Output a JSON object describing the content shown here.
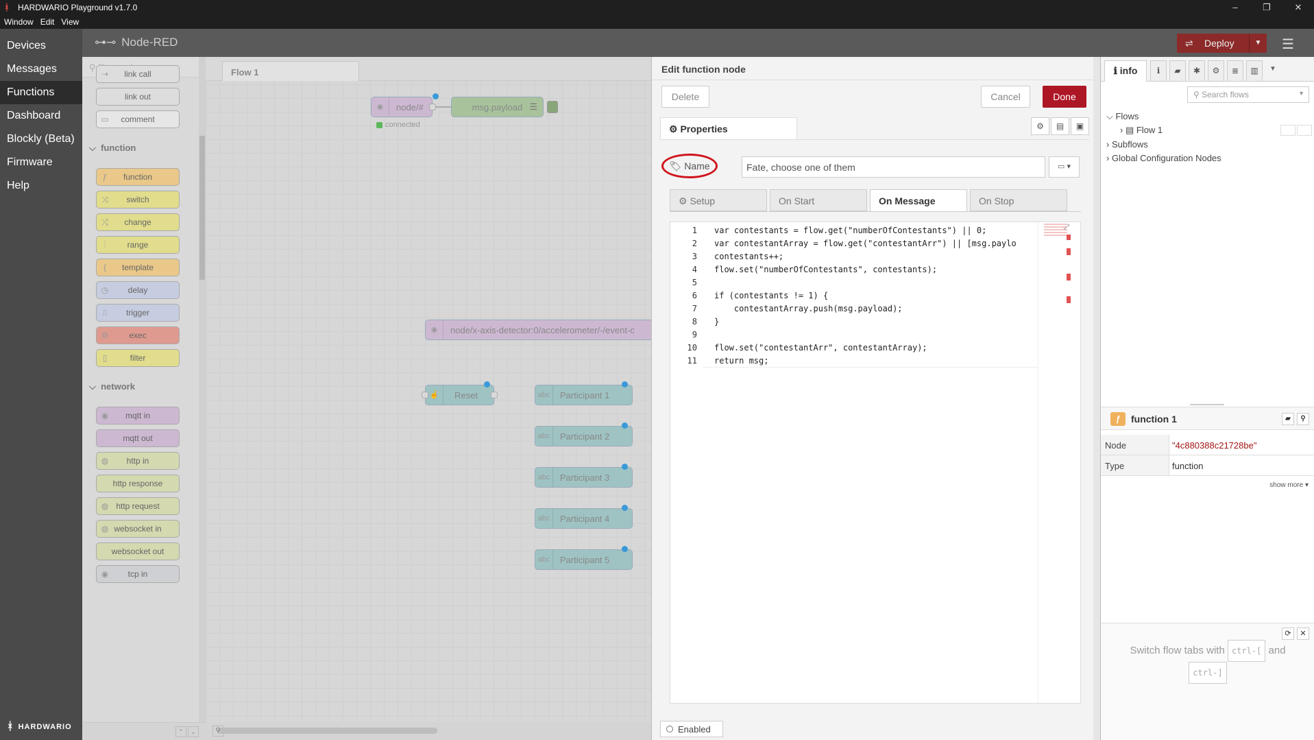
{
  "window": {
    "title": "HARDWARIO Playground v1.7.0",
    "menu": [
      "Window",
      "Edit",
      "View"
    ],
    "controls": {
      "minimize": "–",
      "maximize": "❐",
      "close": "✕"
    }
  },
  "appnav": {
    "items": [
      "Devices",
      "Messages",
      "Functions",
      "Dashboard",
      "Blockly (Beta)",
      "Firmware",
      "Help"
    ],
    "active": "Functions",
    "brand": "HARDWARIO"
  },
  "header": {
    "logo_text": "Node-RED",
    "deploy_label": "Deploy"
  },
  "palette": {
    "filter_placeholder": "filter nodes",
    "top_nodes": [
      "link call",
      "link out",
      "comment"
    ],
    "category_function": "function",
    "function_nodes": [
      "function",
      "switch",
      "change",
      "range",
      "template",
      "delay",
      "trigger",
      "exec",
      "filter"
    ],
    "category_network": "network",
    "network_nodes": [
      "mqtt in",
      "mqtt out",
      "http in",
      "http response",
      "http request",
      "websocket in",
      "websocket out",
      "tcp in"
    ]
  },
  "workspace": {
    "tab": "Flow 1",
    "nodes": {
      "mqtt_in": "node/#",
      "status": "connected",
      "debug": "msg.payload",
      "long_mqtt": "node/x-axis-detector:0/accelerometer/-/event-c",
      "reset": "Reset",
      "participants": [
        "Participant 1",
        "Participant 2",
        "Participant 3",
        "Participant 4",
        "Participant 5"
      ]
    }
  },
  "editor": {
    "title": "Edit function node",
    "delete_label": "Delete",
    "cancel_label": "Cancel",
    "done_label": "Done",
    "properties_tab": "Properties",
    "name_label": "Name",
    "name_value": "Fate, choose one of them",
    "subtabs": [
      "Setup",
      "On Start",
      "On Message",
      "On Stop"
    ],
    "active_subtab": "On Message",
    "code_lines": [
      "var contestants = flow.get(\"numberOfContestants\") || 0;",
      "var contestantArray = flow.get(\"contestantArr\") || [msg.paylo",
      "contestants++;",
      "flow.set(\"numberOfContestants\", contestants);",
      "",
      "if (contestants != 1) {",
      "    contestantArray.push(msg.payload);",
      "}",
      "",
      "flow.set(\"contestantArr\", contestantArray);",
      "return msg;"
    ],
    "line_numbers": [
      "1",
      "2",
      "3",
      "4",
      "5",
      "6",
      "7",
      "8",
      "9",
      "10",
      "11"
    ],
    "enabled_label": "Enabled"
  },
  "sidebar": {
    "info_tab": "info",
    "search_placeholder": "Search flows",
    "tree": {
      "flows": "Flows",
      "flow1": "Flow 1",
      "subflows": "Subflows",
      "global": "Global Configuration Nodes"
    },
    "selected_title": "function 1",
    "node_key": "Node",
    "node_value": "\"4c880388c21728be\"",
    "type_key": "Type",
    "type_value": "function",
    "show_more": "show more ▾",
    "tip_text_1": "Switch flow tabs with",
    "tip_key_1": "ctrl-[",
    "tip_and": "and",
    "tip_key_2": "ctrl-]"
  },
  "colors": {
    "accent": "#ad1625",
    "function_node": "#f0b15c",
    "mqtt_node": "#c0a3c8",
    "ui_node": "#7fbfbf"
  }
}
